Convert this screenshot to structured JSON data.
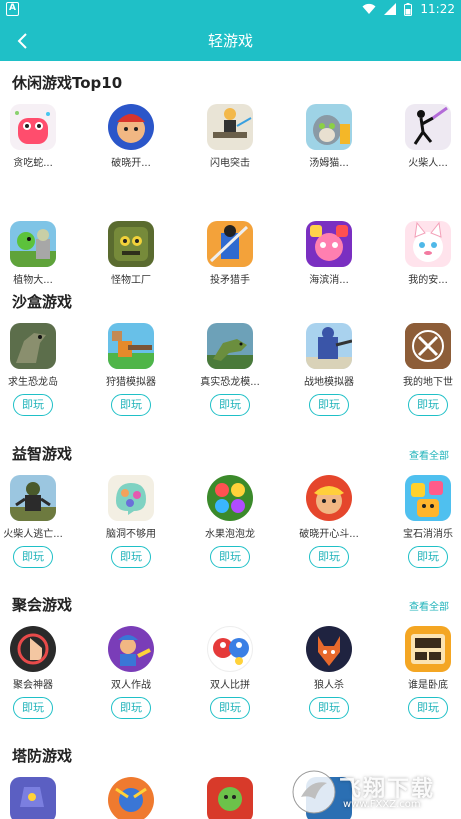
{
  "status_bar": {
    "left_badge": "A",
    "time": "11:22"
  },
  "header": {
    "title": "轻游戏"
  },
  "sections": [
    {
      "title": "休闲游戏Top10",
      "see_all": ""
    },
    {
      "title": "沙盒游戏",
      "see_all": ""
    },
    {
      "title": "益智游戏",
      "see_all": "查看全部"
    },
    {
      "title": "聚会游戏",
      "see_all": "查看全部"
    },
    {
      "title": "塔防游戏",
      "see_all": ""
    }
  ],
  "play_label": "即玩",
  "top10_row1": [
    "贪吃蛇...",
    "破晓开...",
    "闪电突击",
    "汤姆猫...",
    "火柴人..."
  ],
  "top10_row2": [
    "植物大...",
    "怪物工厂",
    "投矛猎手",
    "海滨消...",
    "我的安..."
  ],
  "sandbox": [
    "求生恐龙岛",
    "狩猎模拟器",
    "真实恐龙模...",
    "战地模拟器",
    "我的地下世"
  ],
  "puzzle": [
    "火柴人逃亡...",
    "脑洞不够用",
    "水果泡泡龙",
    "破晓开心斗...",
    "宝石消消乐"
  ],
  "party": [
    "聚会神器",
    "双人作战",
    "双人比拼",
    "狼人杀",
    "谁是卧底"
  ],
  "watermark": {
    "text": "飞翔下载",
    "url": "www.FXXZ.com"
  },
  "colors": {
    "accent": "#1fc0c7"
  }
}
